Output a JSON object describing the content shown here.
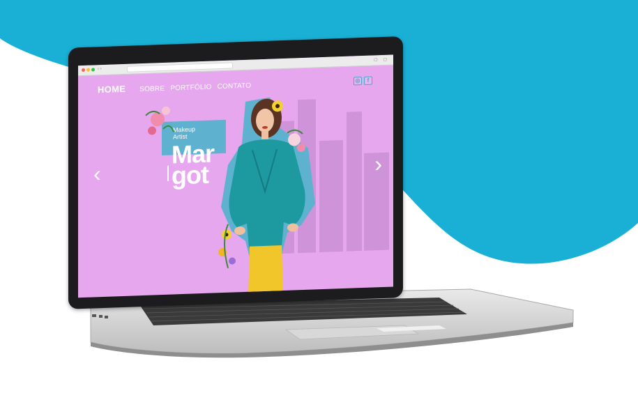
{
  "page": {
    "background_color": "#ffffff",
    "accent_wave_color": "#1ab0d6"
  },
  "browser": {
    "back_icon": "chevron-left-icon",
    "forward_icon": "chevron-right-icon",
    "controls_text": "‹ ›",
    "right_icons_text": "▢ ▢"
  },
  "site": {
    "nav": {
      "home": "HOME",
      "links": [
        "SOBRE",
        "PORTFÓLIO",
        "CONTATO"
      ]
    },
    "social": {
      "instagram_glyph": "◎",
      "facebook_glyph": "f"
    },
    "hero": {
      "subtitle_line1": "Makeup",
      "subtitle_line2": "Artist",
      "name_line1": "Mar",
      "name_line2": "got",
      "background_color": "#e6a7ef",
      "accent_block_color": "#5fb2cf"
    },
    "carousel": {
      "prev_glyph": "‹",
      "next_glyph": "›"
    }
  }
}
